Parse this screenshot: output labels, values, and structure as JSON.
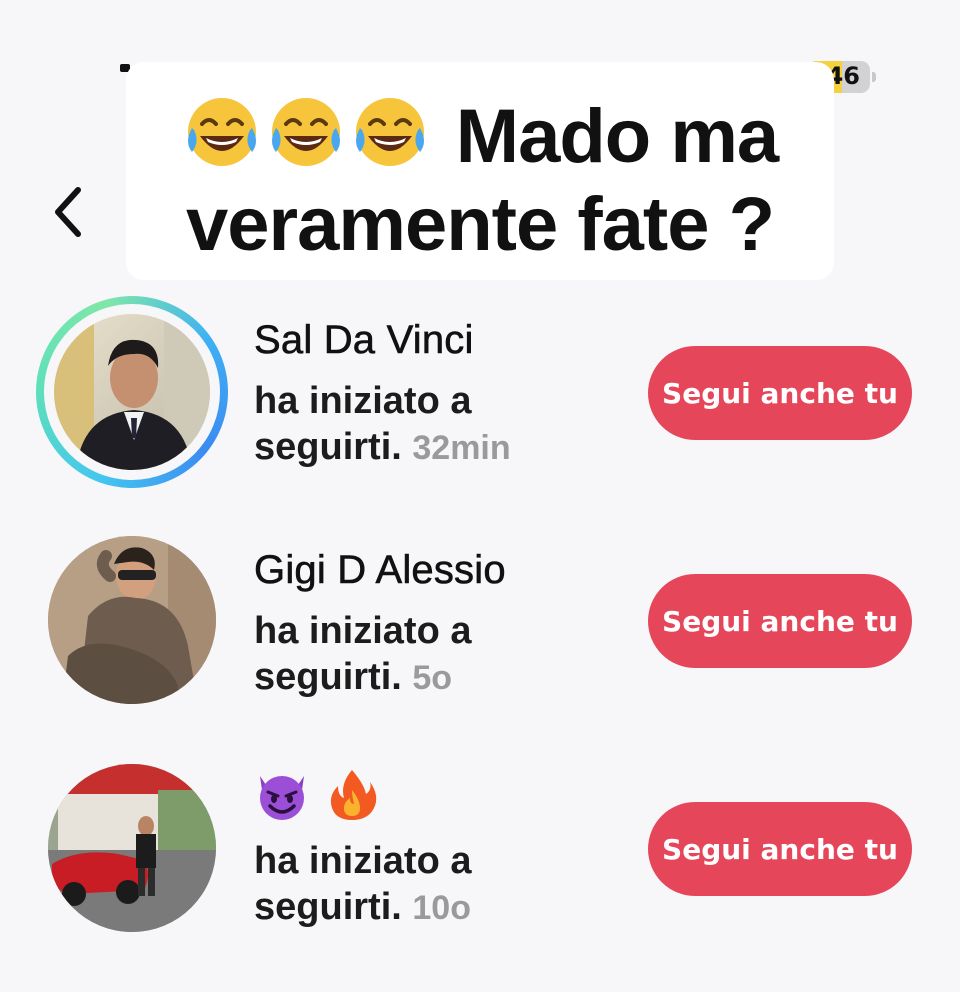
{
  "status_bar": {
    "battery_level": "46",
    "battery_fraction": 0.46,
    "battery_color": "#f4d13e"
  },
  "header": {
    "back_icon": "chevron-left-icon"
  },
  "caption": {
    "emojis": [
      "face-with-tears-of-joy",
      "face-with-tears-of-joy",
      "face-with-tears-of-joy"
    ],
    "line1_text": "Mado ma",
    "line2_text": "veramente fate ?"
  },
  "notifications": [
    {
      "name": "Sal Da Vinci",
      "message": "ha iniziato a seguirti.",
      "time": "32min",
      "button_label": "Segui anche tu",
      "has_story_ring": true
    },
    {
      "name": "Gigi D Alessio",
      "message": "ha iniziato a seguirti.",
      "time": "5o",
      "button_label": "Segui anche tu",
      "has_story_ring": false
    },
    {
      "name_emojis": [
        "smiling-face-with-horns",
        "fire"
      ],
      "message": "ha iniziato a seguirti.",
      "time": "10o",
      "button_label": "Segui anche tu",
      "has_story_ring": false
    }
  ],
  "colors": {
    "follow_button": "#e6465a",
    "background": "#f7f7f9",
    "time_text": "#9a9a9c"
  }
}
